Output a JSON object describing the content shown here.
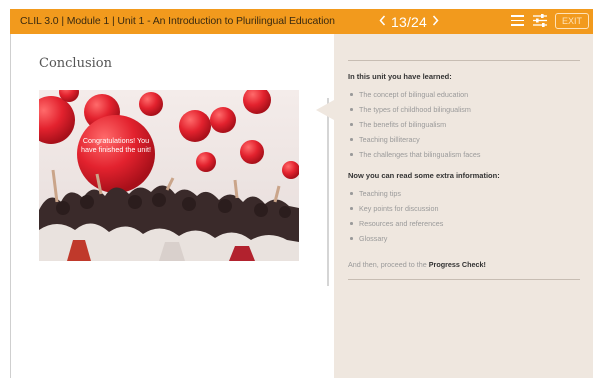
{
  "header": {
    "course_title": "CLIL 3.0 | Module 1 | Unit 1 - An Introduction to Plurilingual Education",
    "prev_icon": "chevron-left",
    "next_icon": "chevron-right",
    "page_indicator": "13/24",
    "menu_icon": "hamburger-menu",
    "settings_icon": "sliders",
    "exit_label": "EXIT"
  },
  "content": {
    "section_title": "Conclusion",
    "image_caption": "Congratulations! You have finished the unit!"
  },
  "summary": {
    "learned_heading": "In this unit you have learned:",
    "learned_items": [
      "The concept of bilingual education",
      "The types of childhood bilingualism",
      "The benefits of bilingualism",
      "Teaching billiteracy",
      "The challenges that bilingualism faces"
    ],
    "extra_heading": "Now you can read some extra information:",
    "extra_items": [
      "Teaching tips",
      "Key points for discussion",
      "Resources and references",
      "Glossary"
    ],
    "proceed_prefix": "And then, proceed to the",
    "proceed_link": "Progress Check!"
  },
  "colors": {
    "topbar": "#f29a1d",
    "panel": "#efe7df",
    "balloon": "#e3222e"
  }
}
